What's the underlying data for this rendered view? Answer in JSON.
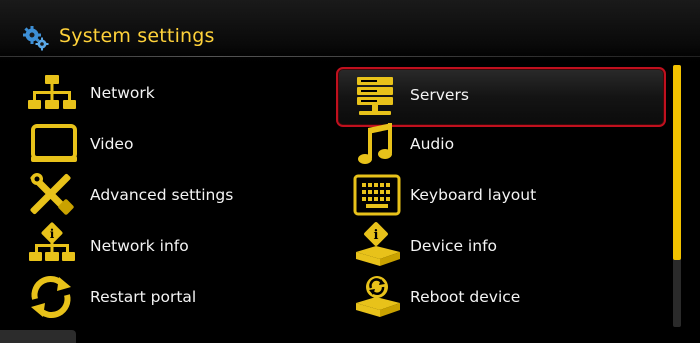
{
  "header": {
    "title": "System settings",
    "icon": "gears-icon"
  },
  "menu": {
    "left": [
      {
        "label": "Network",
        "icon": "network-icon"
      },
      {
        "label": "Video",
        "icon": "monitor-icon"
      },
      {
        "label": "Advanced settings",
        "icon": "tools-icon"
      },
      {
        "label": "Network info",
        "icon": "network-info-icon"
      },
      {
        "label": "Restart portal",
        "icon": "restart-icon"
      }
    ],
    "right": [
      {
        "label": "Servers",
        "icon": "servers-icon",
        "selected": true
      },
      {
        "label": "Audio",
        "icon": "music-note-icon"
      },
      {
        "label": "Keyboard layout",
        "icon": "keyboard-icon"
      },
      {
        "label": "Device info",
        "icon": "device-info-icon"
      },
      {
        "label": "Reboot device",
        "icon": "reboot-icon"
      }
    ]
  },
  "colors": {
    "accent": "#ffd23a",
    "icon": "#e8c21a",
    "selection_border": "#c0101e",
    "scroll_thumb": "#f2c200"
  }
}
